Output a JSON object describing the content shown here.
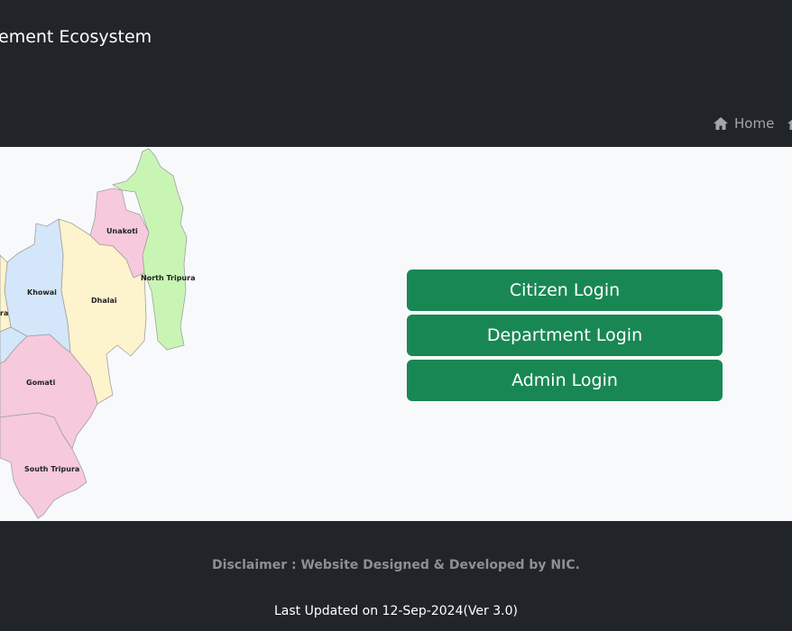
{
  "header": {
    "title": "ement Ecosystem",
    "nav": [
      {
        "label": "Home",
        "icon": "home-icon"
      },
      {
        "label": "",
        "icon": "home-icon"
      }
    ]
  },
  "map": {
    "districts": [
      {
        "name": "Unakoti",
        "color": "#f7c9dd"
      },
      {
        "name": "North Tripura",
        "color": "#c9f5b4"
      },
      {
        "name": "Khowai",
        "color": "#d4e6f9"
      },
      {
        "name": "Dhalai",
        "color": "#fdf3cc"
      },
      {
        "name": "ra",
        "color": "#fdf3cc"
      },
      {
        "name": "Gomati",
        "color": "#f7c9dd"
      },
      {
        "name": "South Tripura",
        "color": "#f7c9dd"
      }
    ]
  },
  "login": {
    "citizen_label": "Citizen Login",
    "department_label": "Department Login",
    "admin_label": "Admin Login"
  },
  "footer": {
    "disclaimer": "Disclaimer : Website Designed & Developed by NIC.",
    "updated": "Last Updated on 12-Sep-2024(Ver 3.0)"
  },
  "colors": {
    "header_bg": "#212529",
    "content_bg": "#f8f9fa",
    "button_green": "#198754"
  }
}
